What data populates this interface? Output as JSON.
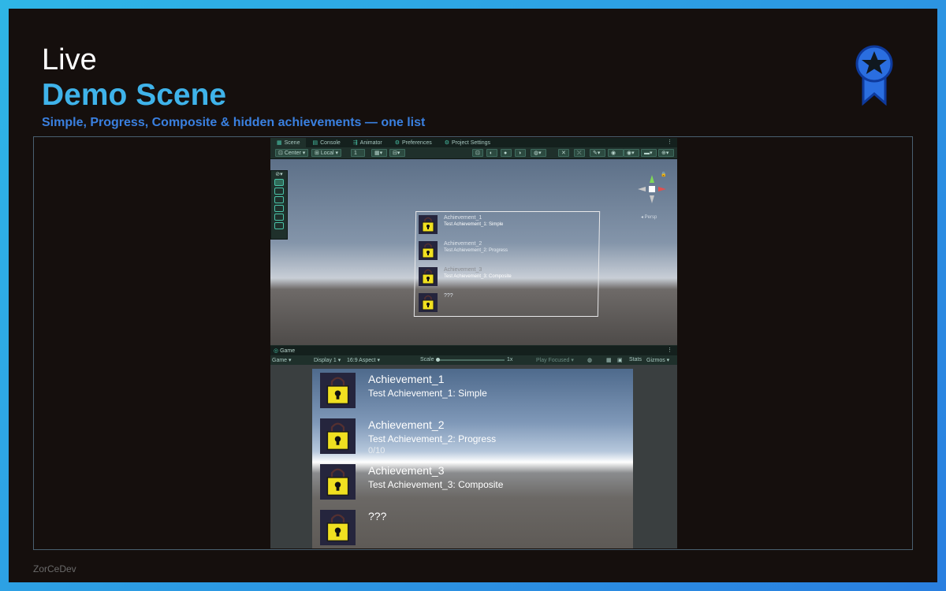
{
  "slide": {
    "title_top": "Live",
    "title_main": "Demo Scene",
    "subtitle": "Simple, Progress, Composite & hidden achievements — one list",
    "footer": "ZorCeDev",
    "badge_icon": "award-ribbon-star-icon",
    "colors": {
      "accent": "#3fb3ea",
      "subtitle": "#3a80e0",
      "background": "#150f0d",
      "border": "#2fb6e6"
    }
  },
  "editor": {
    "tabs": [
      {
        "label": "Scene",
        "icon": "scene-icon"
      },
      {
        "label": "Console",
        "icon": "console-icon"
      },
      {
        "label": "Animator",
        "icon": "animator-icon"
      },
      {
        "label": "Preferences",
        "icon": "gear-icon"
      },
      {
        "label": "Project Settings",
        "icon": "gear-icon"
      }
    ],
    "toolbar": {
      "pivot": "Center",
      "space": "Local",
      "snap": "1"
    },
    "persp_label": "◂ Persp",
    "game_tab": "Game",
    "game_toolbar": {
      "mode": "Game",
      "display": "Display 1",
      "aspect": "16:9 Aspect",
      "scale_label": "Scale",
      "scale_value": "1x",
      "play_focused": "Play Focused",
      "stats": "Stats",
      "gizmos": "Gizmos"
    }
  },
  "achievements": [
    {
      "title": "Achievement_1",
      "description": "Test Achievement_1: Simple",
      "progress": ""
    },
    {
      "title": "Achievement_2",
      "description": "Test Achievement_2: Progress",
      "progress": "0/10"
    },
    {
      "title": "Achievement_3",
      "description": "Test Achievement_3: Composite",
      "progress": ""
    },
    {
      "title": "???",
      "description": "",
      "progress": ""
    }
  ]
}
